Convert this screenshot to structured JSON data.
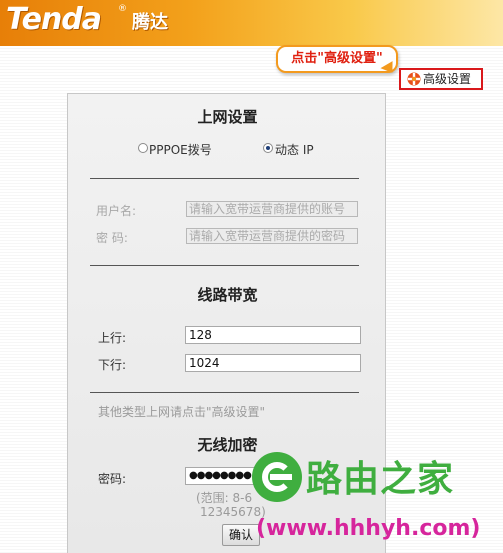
{
  "header": {
    "brand": "Tenda",
    "brand_mark": "®",
    "brand_cn": "腾达"
  },
  "callout": {
    "text": "点击\"高级设置\""
  },
  "advanced_link": {
    "label": "高级设置",
    "icon": "gear-icon"
  },
  "wan": {
    "title": "上网设置",
    "options": [
      {
        "label": "PPPOE拨号",
        "selected": false
      },
      {
        "label": "动态 IP",
        "selected": true
      }
    ],
    "username_label": "用户名:",
    "username_placeholder": "请输入宽带运营商提供的账号",
    "password_label": "密  码:",
    "password_placeholder": "请输入宽带运营商提供的密码"
  },
  "bandwidth": {
    "title": "线路带宽",
    "up_label": "上行:",
    "up_value": "128",
    "down_label": "下行:",
    "down_value": "1024"
  },
  "note": "其他类型上网请点击\"高级设置\"",
  "wireless": {
    "title": "无线加密",
    "password_label": "密码:",
    "password_value": "●●●●●●●●",
    "range_hint": "(范围: 8-6",
    "range_hint2": "12345678)"
  },
  "confirm_label": "确认",
  "watermark": {
    "title": "路由之家",
    "url": "(www.hhhyh.com)"
  },
  "colors": {
    "accent_orange": "#f39a1e",
    "link_red": "#d9181b",
    "watermark_green": "#3fae3f",
    "watermark_pink": "#d6259c"
  }
}
